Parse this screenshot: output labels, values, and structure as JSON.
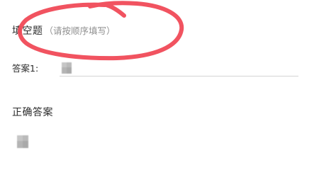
{
  "question": {
    "type_label": "填空题",
    "hint": "（请按顺序填写）"
  },
  "answer_field": {
    "label": "答案1:",
    "value": ""
  },
  "correct_answer": {
    "title": "正确答案"
  },
  "colors": {
    "annotation_stroke": "#f04a57",
    "text": "#2b2b2b",
    "hint": "#8f8f8f",
    "divider": "#d4d4d4"
  }
}
